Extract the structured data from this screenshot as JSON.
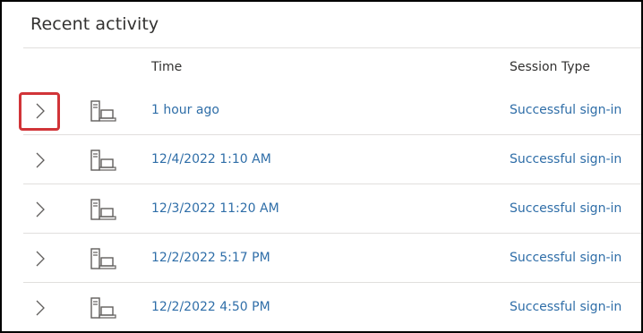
{
  "section": {
    "title": "Recent activity"
  },
  "table": {
    "columns": {
      "time": "Time",
      "session_type": "Session Type"
    },
    "rows": [
      {
        "time": "1 hour ago",
        "session_type": "Successful sign-in",
        "device_icon": "computer-icon",
        "expand_icon": "chevron-right-icon"
      },
      {
        "time": "12/4/2022 1:10 AM",
        "session_type": "Successful sign-in",
        "device_icon": "computer-icon",
        "expand_icon": "chevron-right-icon"
      },
      {
        "time": "12/3/2022 11:20 AM",
        "session_type": "Successful sign-in",
        "device_icon": "computer-icon",
        "expand_icon": "chevron-right-icon"
      },
      {
        "time": "12/2/2022 5:17 PM",
        "session_type": "Successful sign-in",
        "device_icon": "computer-icon",
        "expand_icon": "chevron-right-icon"
      },
      {
        "time": "12/2/2022 4:50 PM",
        "session_type": "Successful sign-in",
        "device_icon": "computer-icon",
        "expand_icon": "chevron-right-icon"
      }
    ]
  },
  "colors": {
    "link": "#2f6ea8",
    "highlight": "#d13438",
    "divider": "#e1dfdd",
    "text": "#323130"
  }
}
